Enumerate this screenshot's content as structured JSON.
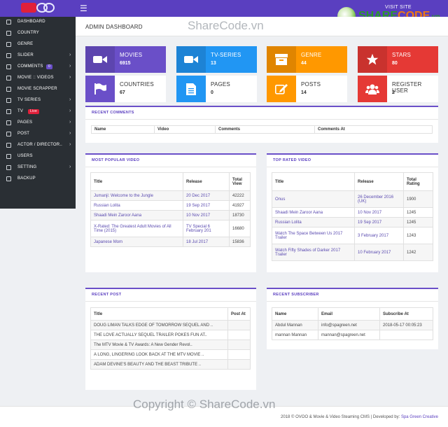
{
  "topbar": {
    "visit_site": "VISIT SITE",
    "sharecode_logo": "SHARECODE.vn"
  },
  "header": {
    "title": "ADMIN DASHBOARD"
  },
  "watermark": "ShareCode.vn",
  "sidebar": {
    "items": [
      {
        "label": "DASHBOARD",
        "icon": "dashboard-icon",
        "arrow": false
      },
      {
        "label": "COUNTRY",
        "icon": "globe-icon",
        "arrow": false
      },
      {
        "label": "GENRE",
        "icon": "tag-icon",
        "arrow": false
      },
      {
        "label": "SLIDER",
        "icon": "image-icon",
        "arrow": true
      },
      {
        "label": "COMMENTS",
        "icon": "comment-icon",
        "arrow": true,
        "badge": "0",
        "badge_color": "#6a4fc8"
      },
      {
        "label": "MOVIE :: VIDEOS",
        "icon": "film-icon",
        "arrow": true
      },
      {
        "label": "MOVIE SCRAPPER",
        "icon": "download-icon",
        "arrow": false
      },
      {
        "label": "TV SERIES",
        "icon": "tv-icon",
        "arrow": true
      },
      {
        "label": "TV",
        "icon": "television-icon",
        "arrow": true,
        "badge": "Live",
        "badge_color": "#e0203a"
      },
      {
        "label": "PAGES",
        "icon": "file-icon",
        "arrow": true
      },
      {
        "label": "POST",
        "icon": "edit-icon",
        "arrow": true
      },
      {
        "label": "ACTOR / DIRECTOR..",
        "icon": "user-icon",
        "arrow": true
      },
      {
        "label": "USERS",
        "icon": "users-icon",
        "arrow": false
      },
      {
        "label": "SETTING",
        "icon": "gear-icon",
        "arrow": true
      },
      {
        "label": "BACKUP",
        "icon": "database-icon",
        "arrow": false
      }
    ]
  },
  "stats": [
    {
      "label": "MOVIES",
      "value": "6915",
      "color": "#6a4fc8",
      "filled": true,
      "icon": "video-camera-icon"
    },
    {
      "label": "TV-SERIES",
      "value": "13",
      "color": "#2196f3",
      "filled": true,
      "icon": "video-camera-icon"
    },
    {
      "label": "GENRE",
      "value": "44",
      "color": "#ff9800",
      "filled": true,
      "icon": "archive-icon"
    },
    {
      "label": "STARS",
      "value": "80",
      "color": "#e53935",
      "filled": true,
      "icon": "star-icon"
    },
    {
      "label": "COUNTRIES",
      "value": "67",
      "color": "#6a4fc8",
      "filled": false,
      "icon": "flag-icon"
    },
    {
      "label": "PAGES",
      "value": "0",
      "color": "#2196f3",
      "filled": false,
      "icon": "document-icon"
    },
    {
      "label": "POSTS",
      "value": "14",
      "color": "#ff9800",
      "filled": false,
      "icon": "pencil-icon"
    },
    {
      "label": "REGISTER USER",
      "value": "2",
      "color": "#e53935",
      "filled": false,
      "icon": "users-icon"
    }
  ],
  "recent_comments": {
    "title": "RECENT COMMENTS",
    "columns": [
      "Name",
      "Video",
      "Comments",
      "Comments At"
    ]
  },
  "most_popular": {
    "title": "MOST POPULAR VIDEO",
    "columns": [
      "Title",
      "Release",
      "Total View"
    ],
    "rows": [
      [
        "Jumanji: Welcome to the Jungle",
        "20 Dec 2017",
        "42222"
      ],
      [
        "Russian Lolita",
        "19 Sep 2017",
        "41927"
      ],
      [
        "Shaadi Mein Zaroor Aana",
        "10 Nov 2017",
        "18730"
      ],
      [
        "X-Rated: The Greatest Adult Movies of All Time (2015)",
        "TV Special 6 February 201",
        "16680"
      ],
      [
        "Japanese Mom",
        "18 Jul 2017",
        "15836"
      ]
    ]
  },
  "top_rated": {
    "title": "TOP RATED VIDEO",
    "columns": [
      "Title",
      "Release",
      "Total Rating"
    ],
    "rows": [
      [
        "Onus",
        "26 December 2016 (UK)",
        "1900"
      ],
      [
        "Shaadi Mein Zaroor Aana",
        "10 Nov 2017",
        "1245"
      ],
      [
        "Russian Lolita",
        "19 Sep 2017",
        "1245"
      ],
      [
        "Watch The Space Between Us 2017 Trailer",
        "3 February 2017",
        "1243"
      ],
      [
        "Watch Fifty Shades of Darker 2017 Trailer",
        "10 February 2017",
        "1242"
      ]
    ]
  },
  "recent_post": {
    "title": "RECENT POST",
    "columns": [
      "Title",
      "Post At"
    ],
    "rows": [
      [
        "DOUG LIMAN TALKS EDGE OF TOMORROW SEQUEL AND ..",
        ""
      ],
      [
        "THE LOVE ACTUALLY SEQUEL TRAILER POKES FUN AT..",
        ""
      ],
      [
        "The MTV Movie & TV Awards: A New Gender Revol..",
        ""
      ],
      [
        "A LONG, LINGERING LOOK BACK AT THE MTV MOVIE ..",
        ""
      ],
      [
        "ADAM DEVINE'S BEAUTY AND THE BEAST TRIBUTE ..",
        ""
      ]
    ]
  },
  "recent_subscriber": {
    "title": "RECENT SUBSCRIBER",
    "columns": [
      "Name",
      "Email",
      "Subscribe At"
    ],
    "rows": [
      [
        "Abdul Mannan",
        "info@spagreen.net",
        "2018-05-17 00:05:23"
      ],
      [
        "mannan Mannan",
        "mannan@spagreen.net",
        ""
      ]
    ]
  },
  "copyright": "Copyright © ShareCode.vn",
  "footer": {
    "text": "2018 © OVOO & Movie & Video Steaming CMS | Developed by:",
    "dev": "Spa Green Creative"
  }
}
